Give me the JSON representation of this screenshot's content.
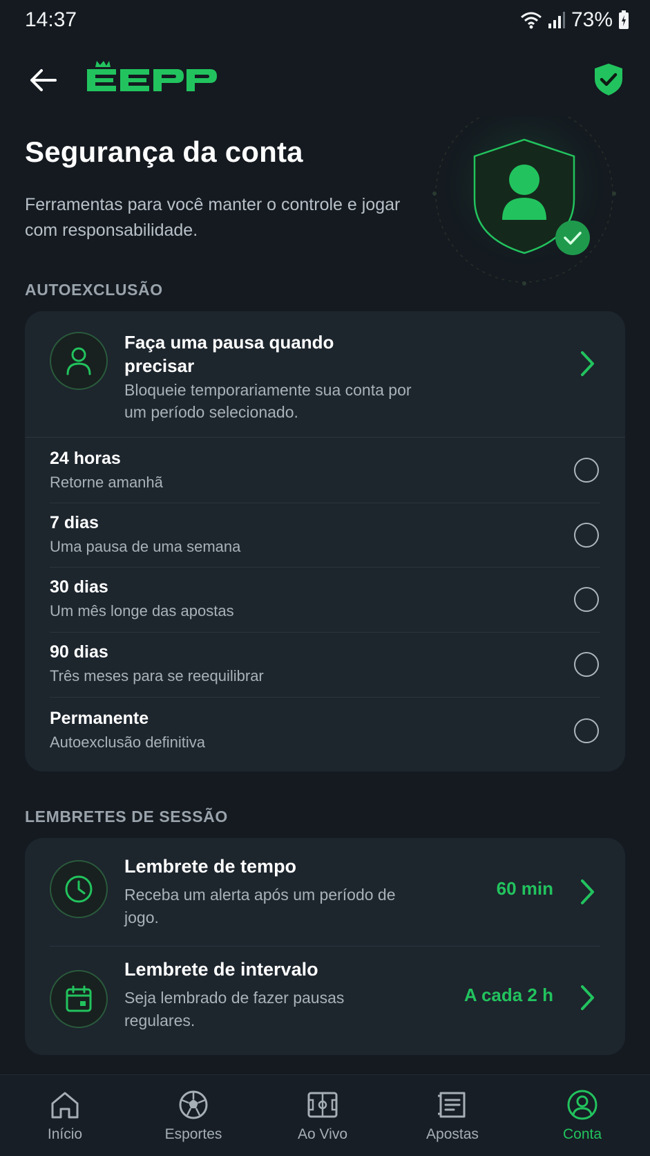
{
  "status_bar": {
    "time": "14:37",
    "battery": "73%"
  },
  "header": {
    "logo_text": "EEPP"
  },
  "hero": {
    "title": "Segurança da conta",
    "subtitle": "Ferramentas para você manter o controle e jogar com responsabilidade."
  },
  "autoexclusion": {
    "section_label": "AUTOEXCLUSÃO",
    "header_item": {
      "title": "Faça uma pausa quando precisar",
      "description": "Bloqueie temporariamente sua conta por um período selecionado."
    },
    "options": [
      {
        "title": "24 horas",
        "description": "Retorne amanhã",
        "selected": false
      },
      {
        "title": "7 dias",
        "description": "Uma pausa de uma semana",
        "selected": false
      },
      {
        "title": "30 dias",
        "description": "Um mês longe das apostas",
        "selected": false
      },
      {
        "title": "90 dias",
        "description": "Três meses para se reequilibrar",
        "selected": false
      },
      {
        "title": "Permanente",
        "description": "Autoexclusão definitiva",
        "selected": false
      }
    ]
  },
  "reminders": {
    "section_label": "LEMBRETES DE SESSÃO",
    "items": [
      {
        "title": "Lembrete de tempo",
        "description": "Receba um alerta após um período de jogo.",
        "value": "60 min",
        "icon": "clock-icon"
      },
      {
        "title": "Lembrete de intervalo",
        "description": "Seja lembrado de fazer pausas regulares.",
        "value": "A cada 2 h",
        "icon": "calendar-icon"
      }
    ]
  },
  "bottom_nav": {
    "items": [
      {
        "label": "Início",
        "icon": "home-icon",
        "active": false
      },
      {
        "label": "Esportes",
        "icon": "soccer-ball-icon",
        "active": false
      },
      {
        "label": "Ao Vivo",
        "icon": "field-icon",
        "active": false
      },
      {
        "label": "Apostas",
        "icon": "ticket-icon",
        "active": false
      },
      {
        "label": "Conta",
        "icon": "account-icon",
        "active": true
      }
    ]
  },
  "colors": {
    "accent": "#22c35e",
    "background": "#141a20",
    "card": "#1d252d"
  }
}
